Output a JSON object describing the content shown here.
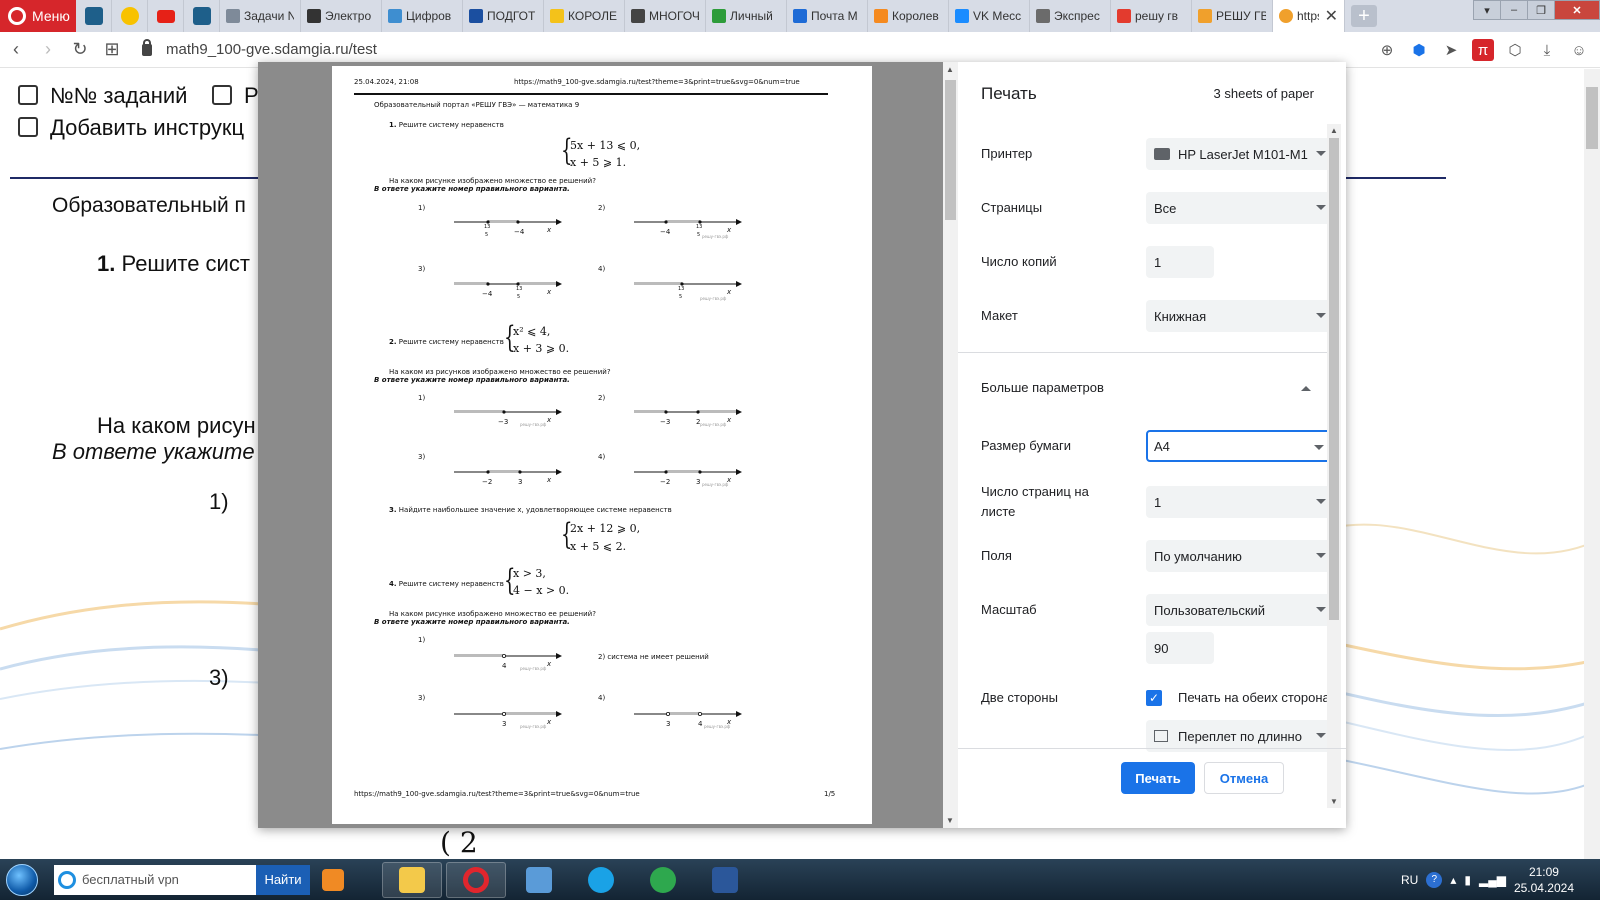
{
  "browser": {
    "menu_label": "Меню",
    "tabs": [
      {
        "label": "Задачи N",
        "color": "#7e8a99"
      },
      {
        "label": "Электро",
        "color": "#333333"
      },
      {
        "label": "Цифров",
        "color": "#3e8ed0"
      },
      {
        "label": "ПОДГОТ",
        "color": "#1b4fa0"
      },
      {
        "label": "КОРОЛЕ",
        "color": "#f4c21a"
      },
      {
        "label": "МНОГОЧ",
        "color": "#444444"
      },
      {
        "label": "Личный",
        "color": "#2d9c3a"
      },
      {
        "label": "Почта М",
        "color": "#1e6bd6"
      },
      {
        "label": "Королев",
        "color": "#f58a1f"
      },
      {
        "label": "VK Месс",
        "color": "#1a8cff"
      },
      {
        "label": "Экспрес",
        "color": "#6b6b6b"
      },
      {
        "label": "решу гв",
        "color": "#e33b2e"
      },
      {
        "label": "РЕШУ ГВ",
        "color": "#f0a02c"
      }
    ],
    "active_tab_label": "https:",
    "url": "math9_100-gve.sdamgia.ru/test"
  },
  "page": {
    "check_task_numbers": "№№ заданий",
    "check_r_fragment": "Р",
    "check_add_instructions": "Добавить инструкц",
    "portal_fragment": "Образовательный п",
    "task1_num": "1.",
    "task1_text": "Решите сист",
    "question_fragment": "На каком рисун",
    "answer_hint_fragment": "В ответе укажите н",
    "opt1": "1)",
    "opt3": "3)"
  },
  "preview": {
    "datetime": "25.04.2024, 21:08",
    "header_url": "https://math9_100-gve.sdamgia.ru/test?theme=3&print=true&svg=0&num=true",
    "portal": "Образовательный портал «РЕШУ ГВЭ» — математика 9",
    "t1_num": "1.",
    "t1_text": "Решите систему неравенств",
    "t1_line1": "5x + 13 ⩽ 0,",
    "t1_line2": "x + 5 ⩾ 1.",
    "q_text": "На каком рисунке изображено множество ее решений?",
    "hint": "В ответе укажите номер правильного варианта.",
    "opts": [
      "1)",
      "2)",
      "3)",
      "4)"
    ],
    "t1_nums": {
      "o1a": "13",
      "o1b": "5",
      "o1c": "−4",
      "o2a": "−4",
      "o2b": "13",
      "o2c": "5",
      "o3a": "−4",
      "o3b": "13",
      "o3c": "5",
      "o4a": "13",
      "o4b": "5"
    },
    "x": "x",
    "wm": "решу-гвэ.рф",
    "t2_num": "2.",
    "t2_text": "Решите систему неравенств",
    "t2_line1": "x² ⩽ 4,",
    "t2_line2": "x + 3 ⩾ 0.",
    "q2_text": "На каком из рисунков изображено множество ее решений?",
    "t2_nums": {
      "o1": "−3",
      "o2a": "−3",
      "o2b": "2",
      "o3a": "−2",
      "o3b": "3",
      "o4a": "−2",
      "o4b": "3"
    },
    "t3_num": "3.",
    "t3_text": "Найдите наибольшее значение x, удовлетворяющее системе неравенств",
    "t3_line1": "2x + 12 ⩾ 0,",
    "t3_line2": "x + 5 ⩽ 2.",
    "t4_num": "4.",
    "t4_text": "Решите систему неравенств",
    "t4_line1": "x > 3,",
    "t4_line2": "4 − x > 0.",
    "t4_nums": {
      "o1": "4",
      "o3": "3",
      "o4a": "3",
      "o4b": "4"
    },
    "t4_opt2_text": "2) система не имеет решений",
    "footer_url": "https://math9_100-gve.sdamgia.ru/test?theme=3&print=true&svg=0&num=true",
    "page_num": "1/5"
  },
  "print": {
    "title": "Печать",
    "sheets": "3 sheets of paper",
    "printer_label": "Принтер",
    "printer_value": "HP LaserJet M101-M1",
    "pages_label": "Страницы",
    "pages_value": "Все",
    "copies_label": "Число копий",
    "copies_value": "1",
    "layout_label": "Макет",
    "layout_value": "Книжная",
    "more_label": "Больше параметров",
    "paper_label": "Размер бумаги",
    "paper_value": "A4",
    "pps_label": "Число страниц на листе",
    "pps_value": "1",
    "margins_label": "Поля",
    "margins_value": "По умолчанию",
    "scale_label": "Масштаб",
    "scale_value": "Пользовательский",
    "scale_custom": "90",
    "duplex_label": "Две стороны",
    "duplex_check_label": "Печать на обеих сторонах",
    "duplex_checked": true,
    "binding_value": "Переплет по длинно",
    "print_button": "Печать",
    "cancel_button": "Отмена"
  },
  "taskbar": {
    "search_text": "бесплатный vpn",
    "search_button": "Найти",
    "lang": "RU",
    "time": "21:09",
    "date": "25.04.2024"
  }
}
